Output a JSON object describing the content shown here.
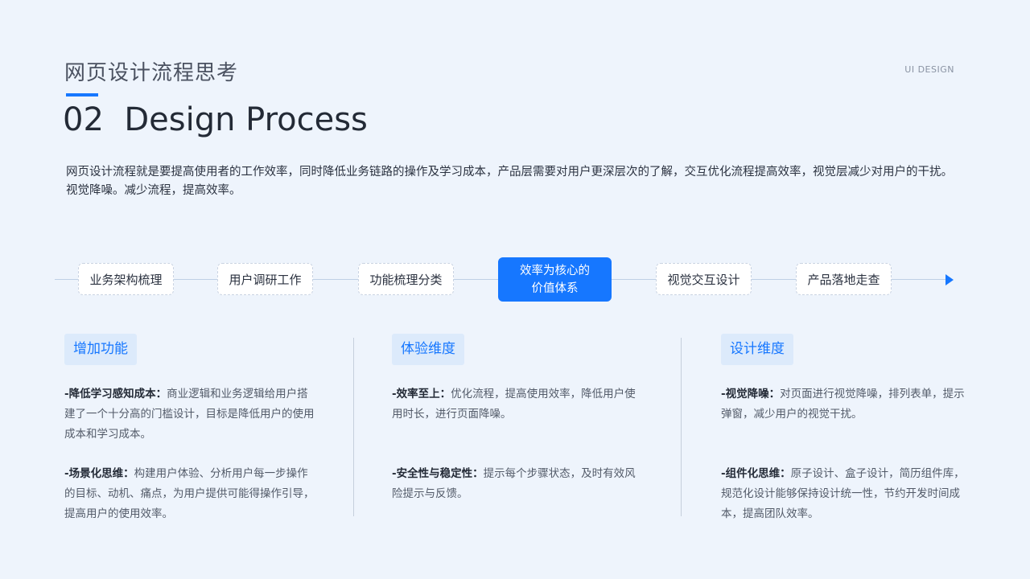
{
  "header": {
    "subtitle": "网页设计流程思考",
    "title": "02  Design Process",
    "tag": "UI DESIGN"
  },
  "intro": "网页设计流程就是要提高使用者的工作效率，同时降低业务链路的操作及学习成本，产品层需要对用户更深层次的了解，交互优化流程提高效率，视觉层减少对用户的干扰。视觉降噪。减少流程，提高效率。",
  "flow": {
    "steps": [
      {
        "label": "业务架构梳理"
      },
      {
        "label": "用户调研工作"
      },
      {
        "label": "功能梳理分类"
      },
      {
        "line1": "效率为核心的",
        "line2": "价值体系"
      },
      {
        "label": "视觉交互设计"
      },
      {
        "label": "产品落地走查"
      }
    ]
  },
  "columns": [
    {
      "heading": "增加功能",
      "items": [
        {
          "title": "-降低学习感知成本：",
          "text": "商业逻辑和业务逻辑给用户搭建了一个十分高的门槛设计，目标是降低用户的使用成本和学习成本。"
        },
        {
          "title": "-场景化思维：",
          "text": "构建用户体验、分析用户每一步操作的目标、动机、痛点，为用户提供可能得操作引导，提高用户的使用效率。"
        }
      ]
    },
    {
      "heading": "体验维度",
      "items": [
        {
          "title": "-效率至上：",
          "text": "优化流程，提高使用效率，降低用户使用时长，进行页面降噪。"
        },
        {
          "title": "-安全性与稳定性：",
          "text": "提示每个步骤状态，及时有效风险提示与反馈。"
        }
      ]
    },
    {
      "heading": "设计维度",
      "items": [
        {
          "title": "-视觉降噪：",
          "text": "对页面进行视觉降噪，排列表单，提示弹窗，减少用户的视觉干扰。"
        },
        {
          "title": "-组件化思维：",
          "text": "原子设计、盒子设计，简历组件库，规范化设计能够保持设计统一性，节约开发时间成本，提高团队效率。"
        }
      ]
    }
  ],
  "colors": {
    "accent": "#1677FF",
    "background": "#EEF4FC",
    "heading_bg": "#DCEAFB"
  }
}
